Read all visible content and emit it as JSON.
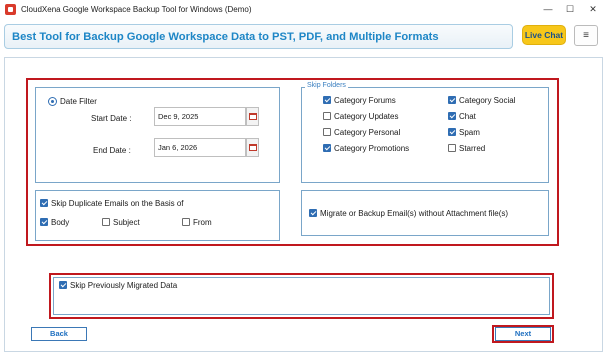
{
  "window": {
    "title": "CloudXena Google Workspace Backup Tool for Windows (Demo)",
    "minimize_glyph": "—",
    "maximize_glyph": "☐",
    "close_glyph": "✕"
  },
  "header": {
    "banner_text": "Best Tool  for Backup Google Workspace Data to PST, PDF, and Multiple Formats",
    "live_chat_label": "Live Chat",
    "menu_glyph": "≡"
  },
  "date_filter": {
    "label": "Date Filter",
    "selected": true,
    "start_label": "Start Date :",
    "start_value": "Dec 9, 2025",
    "end_label": "End Date :",
    "end_value": "Jan 6, 2026"
  },
  "skip_folders": {
    "legend": "Skip Folders",
    "items": [
      {
        "label": "Category Forums",
        "checked": true
      },
      {
        "label": "Category Social",
        "checked": true
      },
      {
        "label": "Category Updates",
        "checked": false
      },
      {
        "label": "Chat",
        "checked": true
      },
      {
        "label": "Category Personal",
        "checked": false
      },
      {
        "label": "Spam",
        "checked": true
      },
      {
        "label": "Category Promotions",
        "checked": true
      },
      {
        "label": "Starred",
        "checked": false
      }
    ]
  },
  "skip_duplicates": {
    "label": "Skip Duplicate Emails on the Basis of",
    "checked": true,
    "options": [
      {
        "label": "Body",
        "checked": true
      },
      {
        "label": "Subject",
        "checked": false
      },
      {
        "label": "From",
        "checked": false
      }
    ]
  },
  "attachments": {
    "label": "Migrate or Backup Email(s) without Attachment file(s)",
    "checked": true
  },
  "skip_migrated": {
    "label": "Skip Previously Migrated Data",
    "checked": true
  },
  "nav": {
    "back_label": "Back",
    "next_label": "Next"
  }
}
